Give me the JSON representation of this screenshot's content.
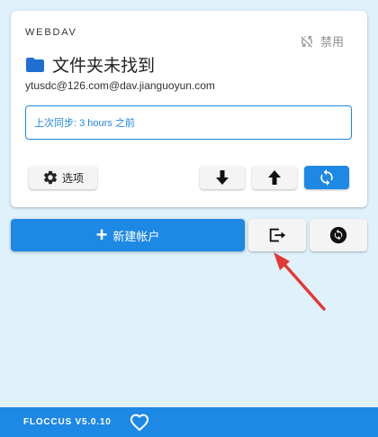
{
  "account": {
    "type_label": "WEBDAV",
    "disabled_label": "禁用",
    "folder_title": "文件夹未找到",
    "url": "ytusdc@126.com@dav.jianguoyun.com",
    "sync_status": "上次同步: 3 hours 之前",
    "options_label": "选项"
  },
  "actions": {
    "new_account_label": "新建帐户"
  },
  "footer": {
    "version": "FLOCCUS V5.0.10"
  },
  "icons": {
    "disabled": "sync-off-icon",
    "folder": "folder-icon",
    "options": "gear-icon",
    "pull": "arrow-down-icon",
    "push": "arrow-up-icon",
    "sync": "sync-icon",
    "export": "export-icon",
    "import": "import-sync-icon",
    "heart": "heart-icon"
  },
  "colors": {
    "accent": "#1e88e5",
    "background": "#dff1fb",
    "annotation": "#e53935"
  }
}
